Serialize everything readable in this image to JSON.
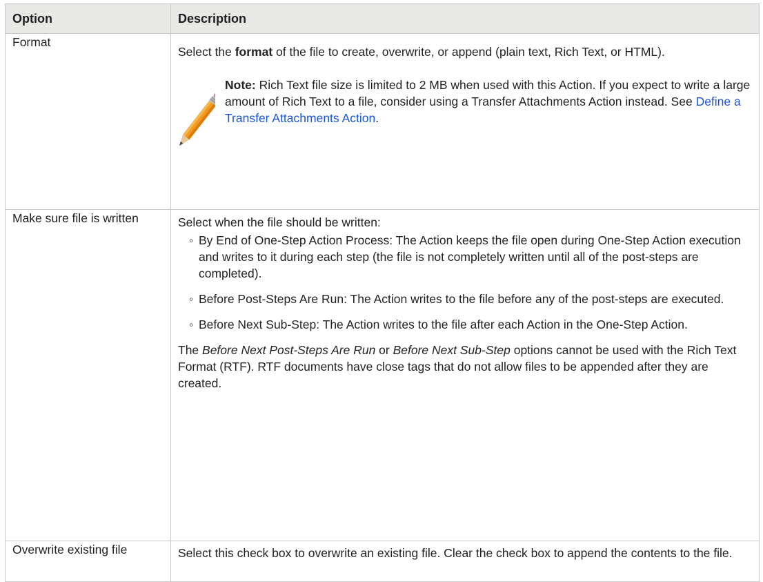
{
  "header": {
    "option": "Option",
    "description": "Description"
  },
  "rows": [
    {
      "option": "Format",
      "desc_pre": "Select the ",
      "desc_bold": "format",
      "desc_post": " of the file to create, overwrite, or append (plain text, Rich Text, or HTML).",
      "note_label": "Note:",
      "note_text": " Rich Text file size is limited to 2 MB when used with this Action. If you expect to write a large amount of Rich Text to a file, consider using a Transfer Attachments Action instead. See ",
      "note_link": "Define a Transfer Attachments Action",
      "note_end": ".",
      "note_icon": "pencil-icon"
    },
    {
      "option": "Make sure file is written",
      "intro": "Select when the file should be written:",
      "bullets": [
        "By End of One-Step Action Process: The Action keeps the file open during One-Step Action execution and writes to it during each step (the file is not completely written until all of the post-steps are completed).",
        "Before Post-Steps Are Run: The Action writes to the file before any of the post-steps are executed.",
        "Before Next Sub-Step: The Action writes to the file after each Action in the One-Step Action."
      ],
      "closing_pre": "The ",
      "closing_em1": "Before Next Post-Steps Are Run",
      "closing_mid": " or ",
      "closing_em2": "Before Next Sub-Step",
      "closing_post": " options cannot be used with the Rich Text Format (RTF). RTF documents have close tags that do not allow files to be appended after they are created."
    },
    {
      "option": "Overwrite existing file",
      "desc": "Select this check box to overwrite an existing file. Clear the check box to append the contents to the file."
    }
  ],
  "colors": {
    "link": "#1a55d6",
    "header_bg": "#e8e8e6",
    "border": "#c8c8c8"
  }
}
